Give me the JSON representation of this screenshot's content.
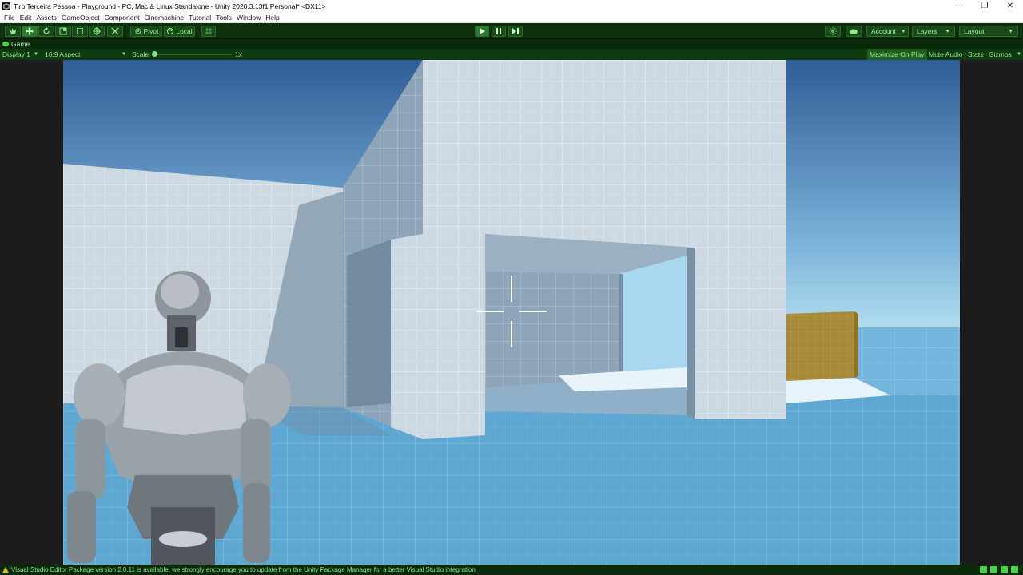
{
  "window": {
    "title": "Tiro Terceira Pessoa - Playground - PC, Mac & Linux Standalone - Unity 2020.3.13f1 Personal* <DX11>",
    "minimize": "—",
    "restore": "❐",
    "close": "✕"
  },
  "menu": {
    "items": [
      "File",
      "Edit",
      "Assets",
      "GameObject",
      "Component",
      "Cinemachine",
      "Tutorial",
      "Tools",
      "Window",
      "Help"
    ]
  },
  "toolbar": {
    "pivot_label": "Pivot",
    "local_label": "Local",
    "account_label": "Account",
    "layers_label": "Layers",
    "layout_label": "Layout"
  },
  "tab": {
    "game_label": "Game"
  },
  "gamebar": {
    "display": "Display 1",
    "aspect": "16:9 Aspect",
    "scale_label": "Scale",
    "scale_value": "1x",
    "maximize_on_play": "Maximize On Play",
    "mute_audio": "Mute Audio",
    "stats": "Stats",
    "gizmos": "Gizmos"
  },
  "status": {
    "message": "Visual Studio Editor Package version 2.0.11 is available, we strongly encourage you to update from the Unity Package Manager for a better Visual Studio integration"
  },
  "colors": {
    "toolbar_bg": "#0c2f0c",
    "accent_green": "#8ff08f",
    "sky_top": "#2f5d95",
    "sky_horizon": "#9fd3ea",
    "floor": "#5ea7d3",
    "wall": "#c6d3dc",
    "crate": "#a78a3a"
  }
}
